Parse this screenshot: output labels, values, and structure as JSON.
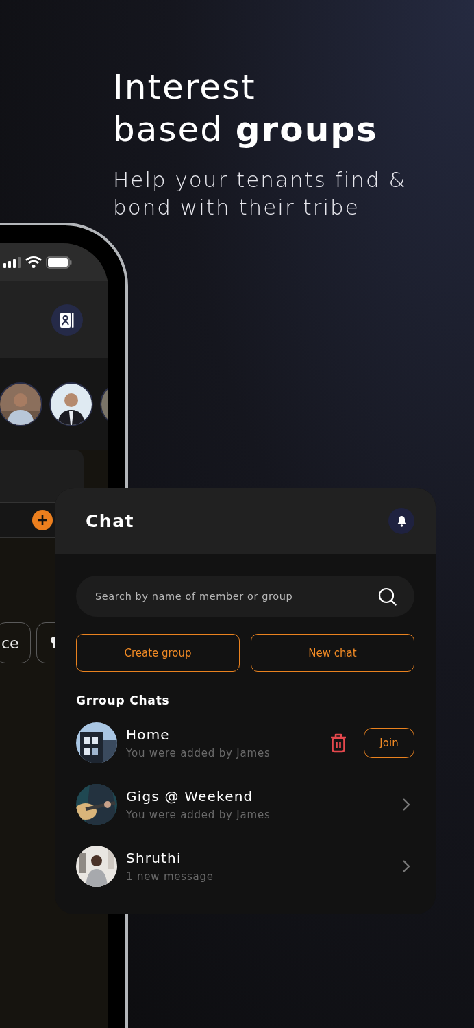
{
  "headline": "Interest\nbased **groups**",
  "subtitle": "Help your tenants find &\nbond with their tribe",
  "phone": {
    "chips": [
      {
        "kind": "text",
        "label": "ce"
      },
      {
        "kind": "icon"
      }
    ]
  },
  "chat": {
    "title": "Chat",
    "search": {
      "placeholder": "Search by name of member or group"
    },
    "buttons": [
      "Create group",
      "New chat"
    ],
    "section_title": "Grroup Chats",
    "groups": [
      {
        "name": "Home",
        "subtitle": "You were added by James",
        "kind": "join",
        "action": "Join"
      },
      {
        "name": "Gigs @ Weekend",
        "subtitle": "You were added by James",
        "kind": "chevron"
      },
      {
        "name": "Shruthi",
        "subtitle": "1 new message",
        "kind": "chevron"
      }
    ]
  }
}
